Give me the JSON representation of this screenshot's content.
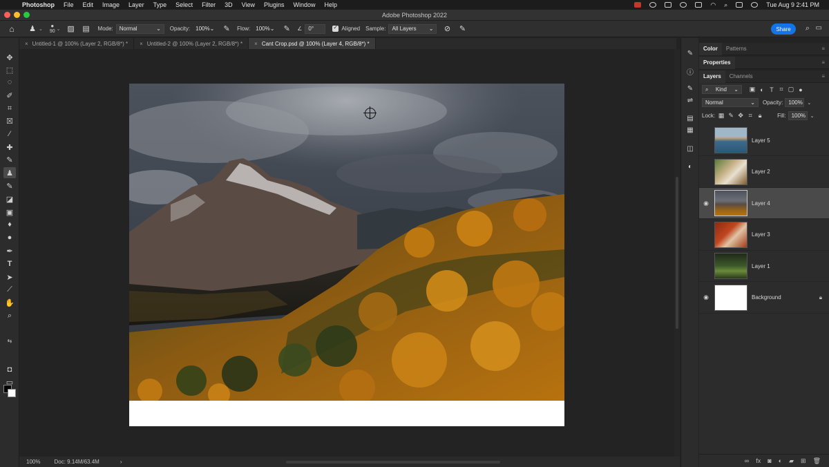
{
  "menubar": {
    "items": [
      "Photoshop",
      "File",
      "Edit",
      "Image",
      "Layer",
      "Type",
      "Select",
      "Filter",
      "3D",
      "View",
      "Plugins",
      "Window",
      "Help"
    ],
    "clock": "Tue Aug 9  2:41 PM"
  },
  "window": {
    "title": "Adobe Photoshop 2022"
  },
  "options": {
    "brush_size": "90",
    "mode_label": "Mode:",
    "mode_value": "Normal",
    "opacity_label": "Opacity:",
    "opacity_value": "100%",
    "flow_label": "Flow:",
    "flow_value": "100%",
    "angle_value": "0°",
    "aligned_label": "Aligned",
    "sample_label": "Sample:",
    "sample_value": "All Layers",
    "share_label": "Share"
  },
  "tabs": [
    {
      "label": "Untitled-1 @ 100% (Layer 2, RGB/8*) *"
    },
    {
      "label": "Untitled-2 @ 100% (Layer 2, RGB/8*) *"
    },
    {
      "label": "Cant Crop.psd @ 100% (Layer 4, RGB/8*) *"
    }
  ],
  "statusbar": {
    "zoom": "100%",
    "doc": "Doc: 9.14M/63.4M",
    "arrow": "›"
  },
  "panels": {
    "color_tabs": [
      "Color",
      "Patterns"
    ],
    "properties_tab": "Properties",
    "layers_tabs": [
      "Layers",
      "Channels"
    ],
    "kind_label": "Kind",
    "blend_mode": "Normal",
    "opacity_label": "Opacity:",
    "opacity_value": "100%",
    "lock_label": "Lock:",
    "fill_label": "Fill:",
    "fill_value": "100%"
  },
  "layers": [
    {
      "name": "Layer 5",
      "visible": false,
      "selected": false,
      "locked": false,
      "thumb": "beach"
    },
    {
      "name": "Layer 2",
      "visible": false,
      "selected": false,
      "locked": false,
      "thumb": "bird"
    },
    {
      "name": "Layer 4",
      "visible": true,
      "selected": true,
      "locked": false,
      "thumb": "mountain"
    },
    {
      "name": "Layer 3",
      "visible": false,
      "selected": false,
      "locked": false,
      "thumb": "red"
    },
    {
      "name": "Layer 1",
      "visible": false,
      "selected": false,
      "locked": false,
      "thumb": "green"
    },
    {
      "name": "Background",
      "visible": true,
      "selected": false,
      "locked": true,
      "thumb": "white"
    }
  ],
  "colors": {
    "accent": "#1473e6",
    "selected_row": "#4a4a4a"
  }
}
